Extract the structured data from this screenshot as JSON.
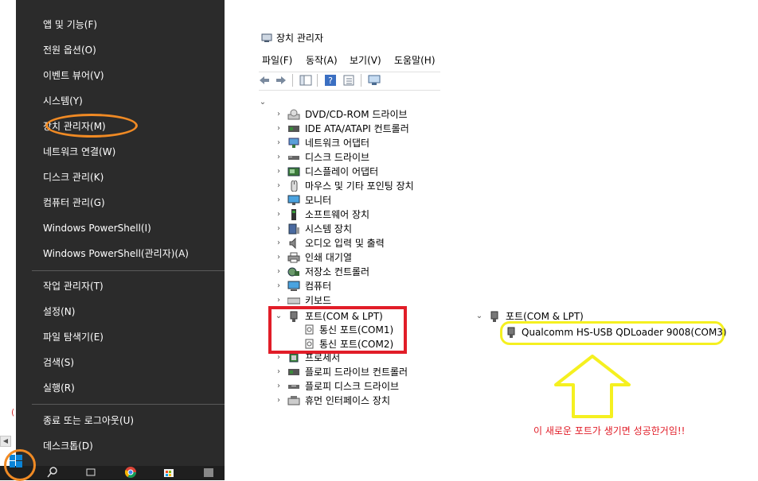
{
  "winx_menu": {
    "items": [
      {
        "label": "앱 및 기능(F)"
      },
      {
        "label": "전원 옵션(O)"
      },
      {
        "label": "이벤트 뷰어(V)"
      },
      {
        "label": "시스템(Y)"
      },
      {
        "label": "장치 관리자(M)"
      },
      {
        "label": "네트워크 연결(W)"
      },
      {
        "label": "디스크 관리(K)"
      },
      {
        "label": "컴퓨터 관리(G)"
      },
      {
        "label": "Windows PowerShell(I)"
      },
      {
        "label": "Windows PowerShell(관리자)(A)"
      },
      {
        "label": "작업 관리자(T)"
      },
      {
        "label": "설정(N)"
      },
      {
        "label": "파일 탐색기(E)"
      },
      {
        "label": "검색(S)"
      },
      {
        "label": "실행(R)"
      },
      {
        "label": "종료 또는 로그아웃(U)"
      },
      {
        "label": "데스크톱(D)"
      }
    ],
    "highlight_color": "#f08a24"
  },
  "device_manager": {
    "title": "장치 관리자",
    "menubar": [
      "파일(F)",
      "동작(A)",
      "보기(V)",
      "도움말(H)"
    ],
    "tree": [
      {
        "label": "DVD/CD-ROM 드라이브"
      },
      {
        "label": "IDE ATA/ATAPI 컨트롤러"
      },
      {
        "label": "네트워크 어댑터"
      },
      {
        "label": "디스크 드라이브"
      },
      {
        "label": "디스플레이 어댑터"
      },
      {
        "label": "마우스 및 기타 포인팅 장치"
      },
      {
        "label": "모니터"
      },
      {
        "label": "소프트웨어 장치"
      },
      {
        "label": "시스템 장치"
      },
      {
        "label": "오디오 입력 및 출력"
      },
      {
        "label": "인쇄 대기열"
      },
      {
        "label": "저장소 컨트롤러"
      },
      {
        "label": "컴퓨터"
      },
      {
        "label": "키보드"
      },
      {
        "label": "포트(COM & LPT)"
      },
      {
        "label": "통신 포트(COM1)"
      },
      {
        "label": "통신 포트(COM2)"
      },
      {
        "label": "프로세서"
      },
      {
        "label": "플로피 드라이브 컨트롤러"
      },
      {
        "label": "플로피 디스크 드라이브"
      },
      {
        "label": "휴먼 인터페이스 장치"
      }
    ],
    "highlight_color": "#e11d28"
  },
  "detail": {
    "port_label": "포트(COM & LPT)",
    "port_child": "Qualcomm HS-USB QDLoader 9008(COM3)",
    "note": "이 새로운 포트가 생기면 성공한거임!!",
    "note_color": "#e11d28",
    "arrow_color": "#f5f020"
  }
}
